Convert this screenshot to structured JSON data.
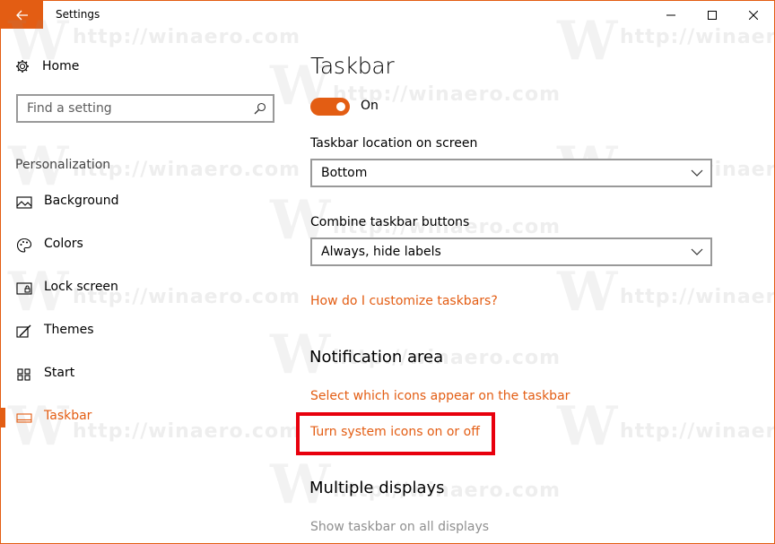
{
  "window": {
    "title": "Settings",
    "accent": "#e35d13",
    "highlight_color": "#e8000d"
  },
  "sidebar": {
    "home_label": "Home",
    "search_placeholder": "Find a setting",
    "section_header": "Personalization",
    "items": [
      {
        "label": "Background",
        "icon": "picture-icon"
      },
      {
        "label": "Colors",
        "icon": "palette-icon"
      },
      {
        "label": "Lock screen",
        "icon": "lock-screen-icon"
      },
      {
        "label": "Themes",
        "icon": "themes-icon"
      },
      {
        "label": "Start",
        "icon": "start-icon"
      },
      {
        "label": "Taskbar",
        "icon": "taskbar-icon",
        "active": true
      }
    ]
  },
  "main": {
    "title": "Taskbar",
    "toggle_state": "On",
    "location_label": "Taskbar location on screen",
    "location_value": "Bottom",
    "combine_label": "Combine taskbar buttons",
    "combine_value": "Always, hide labels",
    "customize_link": "How do I customize taskbars?",
    "notification_header": "Notification area",
    "select_icons_link": "Select which icons appear on the taskbar",
    "system_icons_link": "Turn system icons on or off",
    "multiple_displays_header": "Multiple displays",
    "show_all_displays": "Show taskbar on all displays"
  },
  "watermark": {
    "text": "http://winaero.com",
    "letter": "W"
  }
}
